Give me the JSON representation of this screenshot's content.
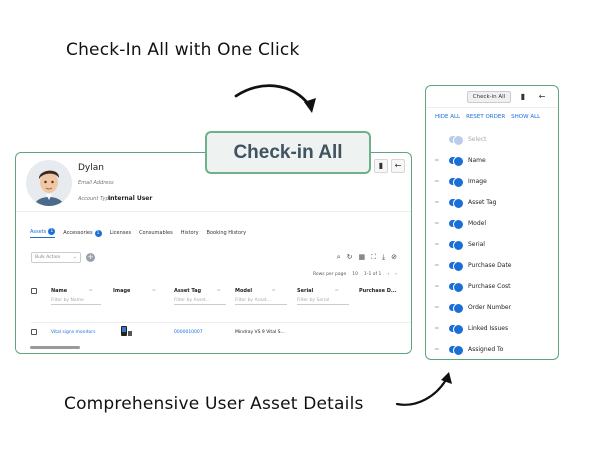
{
  "captions": {
    "top": "Check-In All with One Click",
    "bottom": "Comprehensive User Asset Details"
  },
  "callout": {
    "label": "Check-in All"
  },
  "profile": {
    "name": "Dylan",
    "email_label": "Email Address",
    "account_type_label": "Account Type",
    "account_type_value": "Internal User"
  },
  "tabs": [
    {
      "label": "Assets",
      "count": "1",
      "active": true
    },
    {
      "label": "Accessories",
      "count": "1"
    },
    {
      "label": "Licenses"
    },
    {
      "label": "Consumables"
    },
    {
      "label": "History"
    },
    {
      "label": "Booking History"
    }
  ],
  "toolbar": {
    "bulk_action_placeholder": "Bulk Action",
    "rows_per_page_label": "Rows per page",
    "rows_per_page_value": "10",
    "page_range": "1-1 of 1"
  },
  "table": {
    "columns": [
      {
        "label": "Name",
        "filter": "Filter by Name"
      },
      {
        "label": "Image",
        "filter": ""
      },
      {
        "label": "Asset Tag",
        "filter": "Filter by Asset..."
      },
      {
        "label": "Model",
        "filter": "Filter by Asset..."
      },
      {
        "label": "Serial",
        "filter": "Filter by Serial"
      },
      {
        "label": "Purchase D...",
        "filter": ""
      }
    ],
    "rows": [
      {
        "name": "Vital signs monitors",
        "asset_tag": "0000010007",
        "model": "Mindray VS 9 Vital S..."
      }
    ]
  },
  "panel": {
    "check_in_label": "Check-in All",
    "actions": [
      "HIDE ALL",
      "RESET ORDER",
      "SHOW ALL"
    ],
    "items": [
      {
        "label": "Select",
        "disabled": true
      },
      {
        "label": "Name"
      },
      {
        "label": "Image"
      },
      {
        "label": "Asset Tag"
      },
      {
        "label": "Model"
      },
      {
        "label": "Serial"
      },
      {
        "label": "Purchase Date"
      },
      {
        "label": "Purchase Cost"
      },
      {
        "label": "Order Number"
      },
      {
        "label": "Linked Issues"
      },
      {
        "label": "Assigned To"
      }
    ]
  },
  "colors": {
    "accent": "#1a6fd6",
    "frame": "#5fa57b",
    "callout_bg": "#eef2f1"
  }
}
